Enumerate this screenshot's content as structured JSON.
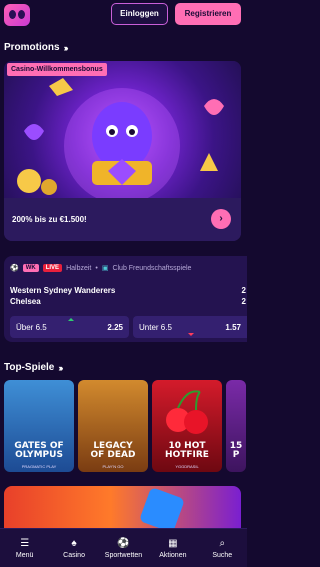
{
  "header": {
    "login_label": "Einloggen",
    "register_label": "Registrieren"
  },
  "promotions": {
    "title": "Promotions",
    "card": {
      "tag": "Casino-Willkommensbonus",
      "text": "200% bis zu €1.500!"
    }
  },
  "match": {
    "badge_wk": "WK",
    "badge_live": "LIVE",
    "status": "Halbzeit",
    "competition": "Club Freundschaftsspiele",
    "teams": [
      {
        "name": "Western Sydney Wanderers",
        "score": "2"
      },
      {
        "name": "Chelsea",
        "score": "2"
      }
    ],
    "odds": [
      {
        "label": "Über 6.5",
        "value": "2.25"
      },
      {
        "label": "Unter 6.5",
        "value": "1.57"
      }
    ]
  },
  "top_games": {
    "title": "Top-Spiele",
    "games": [
      {
        "name_line1": "GATES OF",
        "name_line2": "OLYMPUS",
        "provider": "PRAGMATIC PLAY"
      },
      {
        "name_line1": "LEGACY",
        "name_line2": "OF DEAD",
        "provider": "PLAY'N GO"
      },
      {
        "name_line1": "10 HOT",
        "name_line2": "HOTFIRE",
        "provider": "YGGDRASIL"
      },
      {
        "name_line1": "15",
        "name_line2": "P",
        "provider": ""
      }
    ]
  },
  "nav": {
    "items": [
      {
        "label": "Menü",
        "icon": "menu-icon"
      },
      {
        "label": "Casino",
        "icon": "casino-icon"
      },
      {
        "label": "Sportwetten",
        "icon": "football-icon"
      },
      {
        "label": "Aktionen",
        "icon": "gift-icon"
      },
      {
        "label": "Suche",
        "icon": "search-icon"
      }
    ]
  },
  "colors": {
    "background": "#14092f",
    "accent": "#ff6eb4",
    "card": "#241350",
    "live": "#e8203c"
  }
}
